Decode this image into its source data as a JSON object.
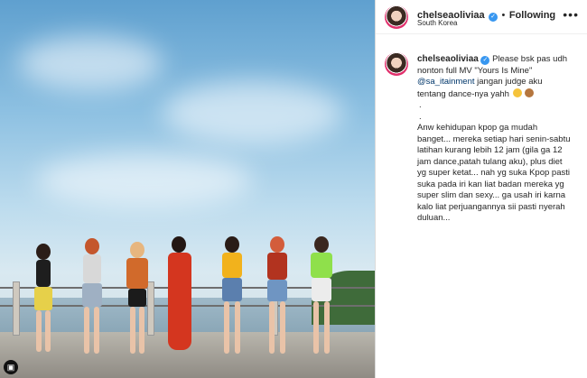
{
  "post": {
    "multi_icon": "▣"
  },
  "header": {
    "username": "chelseaoliviaa",
    "verified_mark": "✓",
    "separator": "•",
    "follow_status": "Following",
    "location": "South Korea",
    "more_label": "•••"
  },
  "caption": {
    "username": "chelseaoliviaa",
    "verified_mark": "✓",
    "line_1": " Please bsk pas udh nonton full MV \"Yours Is Mine\"",
    "mention": "@sa_itainment",
    "line_2": " jangan judge aku tentang dance-nya yahh",
    "dot_1": ".",
    "dot_2": ".",
    "body": "Anw kehidupan kpop ga mudah banget... mereka setiap hari senin-sabtu latihan kurang lebih 12 jam (gila ga 12 jam dance,patah tulang aku), plus diet yg super ketat... nah yg suka Kpop pasti suka pada iri kan liat badan mereka yg super slim dan sexy... ga usah iri karna kalo liat perjuangannya sii pasti nyerah duluan..."
  },
  "colors": {
    "verified": "#3897f0",
    "mention": "#00376b",
    "story_ring": "#e1306c"
  },
  "icons": [
    "multiple-photos-icon",
    "verified-badge-icon",
    "more-options-icon",
    "emoji-icon"
  ]
}
